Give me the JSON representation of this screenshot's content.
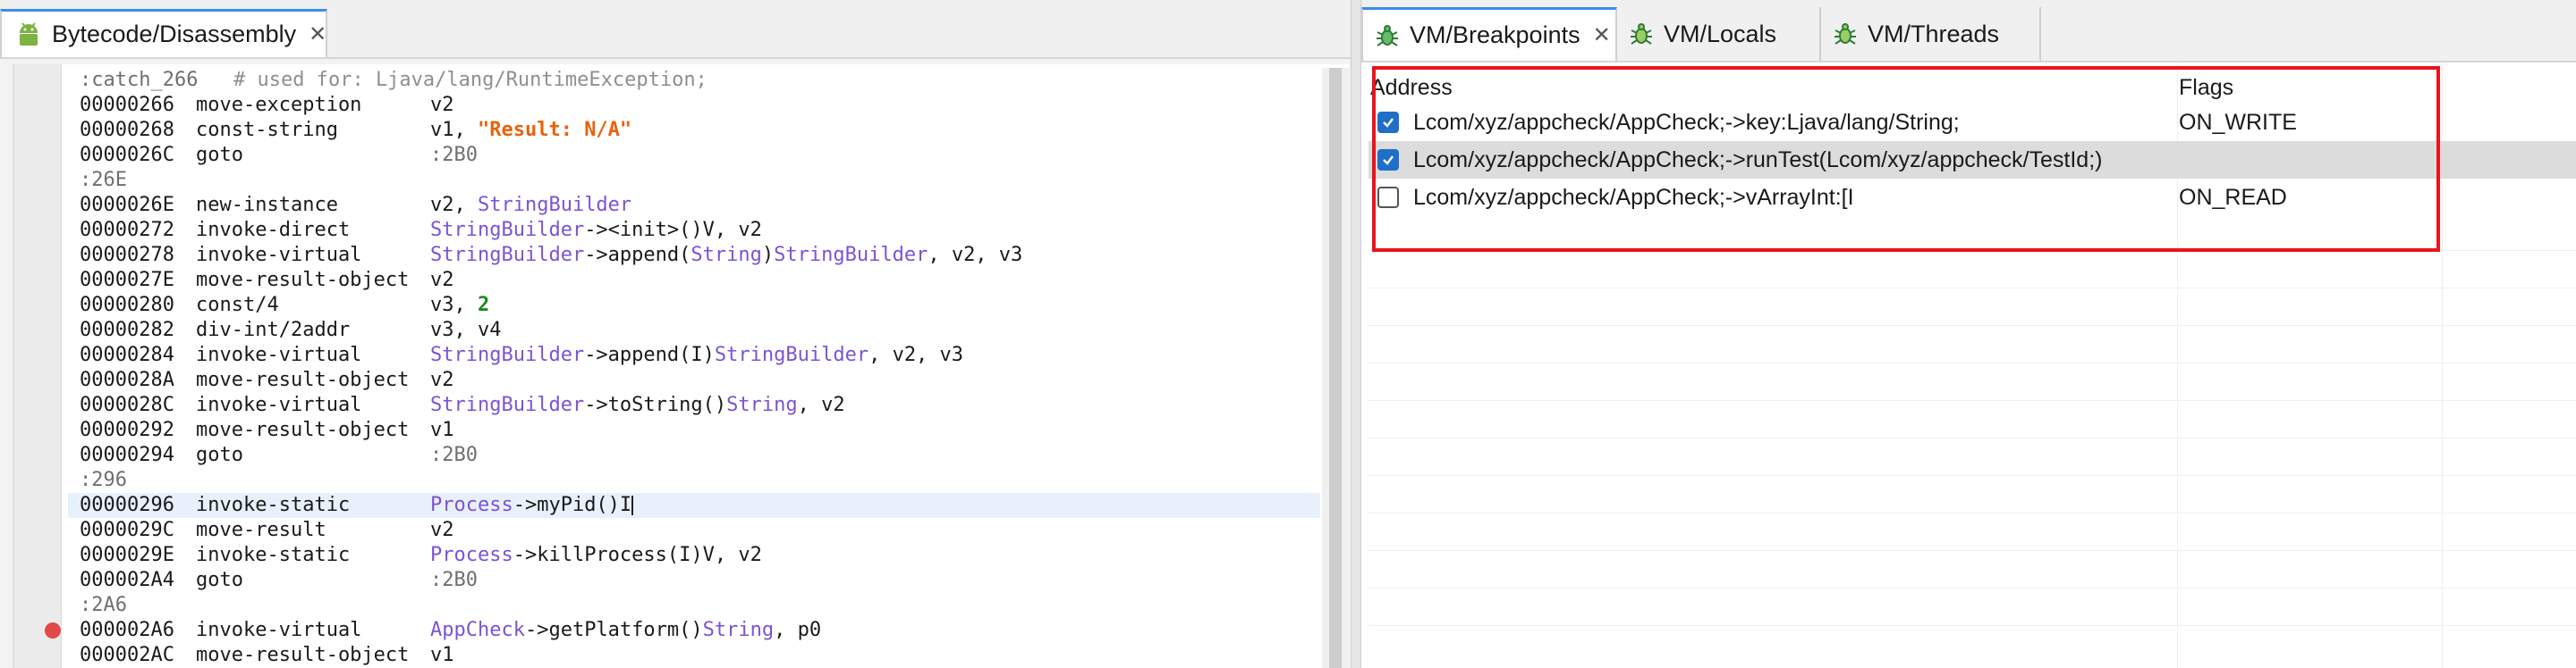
{
  "left_panel": {
    "tab": {
      "title": "Bytecode/Disassembly",
      "icon": "android-icon"
    },
    "lines": [
      {
        "label": ":catch_266",
        "comment": "# used for: Ljava/lang/RuntimeException;"
      },
      {
        "addr": "00000266",
        "op": "move-exception",
        "args": [
          {
            "t": "v2"
          }
        ]
      },
      {
        "addr": "00000268",
        "op": "const-string",
        "args": [
          {
            "t": "v1, "
          },
          {
            "t": "\"Result: N/A\"",
            "k": "str"
          }
        ]
      },
      {
        "addr": "0000026C",
        "op": "goto",
        "args": [
          {
            "t": ":2B0",
            "k": "lbl"
          }
        ]
      },
      {
        "label": ":26E"
      },
      {
        "addr": "0000026E",
        "op": "new-instance",
        "args": [
          {
            "t": "v2, "
          },
          {
            "t": "StringBuilder",
            "k": "type"
          }
        ]
      },
      {
        "addr": "00000272",
        "op": "invoke-direct",
        "args": [
          {
            "t": "StringBuilder",
            "k": "type"
          },
          {
            "t": "-><init>()V, v2"
          }
        ]
      },
      {
        "addr": "00000278",
        "op": "invoke-virtual",
        "args": [
          {
            "t": "StringBuilder",
            "k": "type"
          },
          {
            "t": "->append("
          },
          {
            "t": "String",
            "k": "type"
          },
          {
            "t": ")"
          },
          {
            "t": "StringBuilder",
            "k": "type"
          },
          {
            "t": ", v2, v3"
          }
        ]
      },
      {
        "addr": "0000027E",
        "op": "move-result-object",
        "args": [
          {
            "t": "v2"
          }
        ]
      },
      {
        "addr": "00000280",
        "op": "const/4",
        "args": [
          {
            "t": "v3, "
          },
          {
            "t": "2",
            "k": "num"
          }
        ]
      },
      {
        "addr": "00000282",
        "op": "div-int/2addr",
        "args": [
          {
            "t": "v3, v4"
          }
        ]
      },
      {
        "addr": "00000284",
        "op": "invoke-virtual",
        "args": [
          {
            "t": "StringBuilder",
            "k": "type"
          },
          {
            "t": "->append(I)"
          },
          {
            "t": "StringBuilder",
            "k": "type"
          },
          {
            "t": ", v2, v3"
          }
        ]
      },
      {
        "addr": "0000028A",
        "op": "move-result-object",
        "args": [
          {
            "t": "v2"
          }
        ]
      },
      {
        "addr": "0000028C",
        "op": "invoke-virtual",
        "args": [
          {
            "t": "StringBuilder",
            "k": "type"
          },
          {
            "t": "->toString()"
          },
          {
            "t": "String",
            "k": "type"
          },
          {
            "t": ", v2"
          }
        ]
      },
      {
        "addr": "00000292",
        "op": "move-result-object",
        "args": [
          {
            "t": "v1"
          }
        ]
      },
      {
        "addr": "00000294",
        "op": "goto",
        "args": [
          {
            "t": ":2B0",
            "k": "lbl"
          }
        ]
      },
      {
        "label": ":296"
      },
      {
        "addr": "00000296",
        "op": "invoke-static",
        "args": [
          {
            "t": "Process",
            "k": "type"
          },
          {
            "t": "->myPid()I"
          }
        ],
        "current": true,
        "caret": true
      },
      {
        "addr": "0000029C",
        "op": "move-result",
        "args": [
          {
            "t": "v2"
          }
        ]
      },
      {
        "addr": "0000029E",
        "op": "invoke-static",
        "args": [
          {
            "t": "Process",
            "k": "type"
          },
          {
            "t": "->killProcess(I)V, v2"
          }
        ]
      },
      {
        "addr": "000002A4",
        "op": "goto",
        "args": [
          {
            "t": ":2B0",
            "k": "lbl"
          }
        ]
      },
      {
        "label": ":2A6"
      },
      {
        "addr": "000002A6",
        "op": "invoke-virtual",
        "args": [
          {
            "t": "AppCheck",
            "k": "type"
          },
          {
            "t": "->getPlatform()"
          },
          {
            "t": "String",
            "k": "type"
          },
          {
            "t": ", p0"
          }
        ],
        "breakpoint": true
      },
      {
        "addr": "000002AC",
        "op": "move-result-object",
        "args": [
          {
            "t": "v1"
          }
        ]
      }
    ]
  },
  "right_panel": {
    "tabs": [
      {
        "title": "VM/Breakpoints",
        "icon": "bug-icon",
        "active": true,
        "closable": true
      },
      {
        "title": "VM/Locals",
        "icon": "bug-icon",
        "active": false
      },
      {
        "title": "VM/Threads",
        "icon": "bug-icon",
        "active": false
      }
    ],
    "columns": {
      "address": "Address",
      "flags": "Flags"
    },
    "breakpoints": [
      {
        "checked": true,
        "address": "Lcom/xyz/appcheck/AppCheck;->key:Ljava/lang/String;",
        "flags": "ON_WRITE",
        "selected": false
      },
      {
        "checked": true,
        "address": "Lcom/xyz/appcheck/AppCheck;->runTest(Lcom/xyz/appcheck/TestId;)",
        "flags": "",
        "selected": true
      },
      {
        "checked": false,
        "address": "Lcom/xyz/appcheck/AppCheck;->vArrayInt:[I",
        "flags": "ON_READ",
        "selected": false
      }
    ],
    "highlight_color": "#e8141e"
  },
  "colors": {
    "accent": "#3b8ee8",
    "type": "#7b53d6",
    "string": "#e8620d",
    "number": "#1e8a1e",
    "breakpoint": "#e14a4a",
    "checkbox": "#1f6fc8"
  }
}
